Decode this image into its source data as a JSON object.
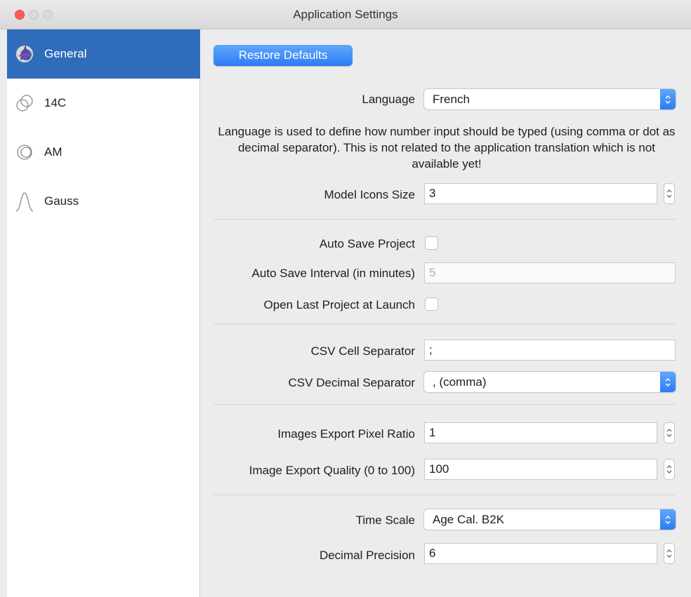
{
  "window": {
    "title": "Application Settings"
  },
  "sidebar": {
    "items": [
      {
        "label": "General",
        "icon": "general-logo-icon",
        "active": true
      },
      {
        "label": "14C",
        "icon": "14c-icon",
        "active": false
      },
      {
        "label": "AM",
        "icon": "am-icon",
        "active": false
      },
      {
        "label": "Gauss",
        "icon": "gauss-curve-icon",
        "active": false
      }
    ]
  },
  "general": {
    "restore_label": "Restore Defaults",
    "language": {
      "label": "Language",
      "value": "French"
    },
    "language_note": "Language is used to define how number input should be typed (using comma or dot as decimal separator). This is not related to the application translation which is not available yet!",
    "model_icons_size": {
      "label": "Model Icons Size",
      "value": "3"
    },
    "auto_save_project": {
      "label": "Auto Save Project",
      "checked": false
    },
    "auto_save_interval": {
      "label": "Auto Save Interval (in minutes)",
      "value": "5"
    },
    "open_last_project": {
      "label": "Open Last Project at Launch",
      "checked": false
    },
    "csv_cell_separator": {
      "label": "CSV Cell Separator",
      "value": ";"
    },
    "csv_decimal_separator": {
      "label": "CSV Decimal Separator",
      "value": ", (comma)"
    },
    "images_export_pixel_ratio": {
      "label": "Images Export Pixel Ratio",
      "value": "1"
    },
    "image_export_quality": {
      "label": "Image Export Quality (0 to 100)",
      "value": "100"
    },
    "time_scale": {
      "label": "Time Scale",
      "value": "Age Cal. B2K"
    },
    "decimal_precision": {
      "label": "Decimal Precision",
      "value": "6"
    }
  },
  "colors": {
    "accent": "#2c7cf5",
    "sidebar_selected": "#2f6dba",
    "close_button": "#fc5f57"
  }
}
